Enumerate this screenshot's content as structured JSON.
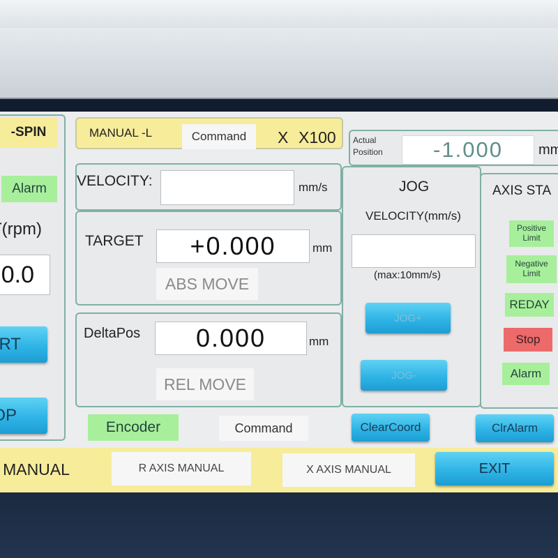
{
  "spindle_panel": {
    "title": "-SPIN",
    "alarm": "Alarm",
    "speed_label": "T(rpm)",
    "speed_value": "0.0",
    "start_button": "RT",
    "stop_button": "OP"
  },
  "header": {
    "mode": "MANUAL -L",
    "mode_button": "Command",
    "axis": "X",
    "scale": "X100",
    "actual_position_label": "Actual Position",
    "actual_position_value": "-1.000",
    "actual_position_unit": "mm"
  },
  "velocity": {
    "label": "VELOCITY:",
    "value": "",
    "unit": "mm/s"
  },
  "absolute": {
    "label": "TARGET",
    "value": "+0.000",
    "unit": "mm",
    "button": "ABS MOVE"
  },
  "relative": {
    "label": "DeltaPos",
    "value": "0.000",
    "unit": "mm",
    "button": "REL MOVE"
  },
  "jog": {
    "title": "JOG",
    "velocity_label": "VELOCITY(mm/s)",
    "velocity_value": "",
    "max_note": "(max:10mm/s)",
    "plus_button": "JOG+",
    "minus_button": "JOG-"
  },
  "axis_status": {
    "title": "AXIS STA",
    "positive_limit": "Positive Limit",
    "negative_limit": "Negative Limit",
    "ready": "REDAY",
    "stop": "Stop",
    "alarm": "Alarm"
  },
  "source_row": {
    "encoder": "Encoder",
    "command": "Command",
    "clear_coord": "ClearCoord",
    "clear_alarm": "ClrAlarm"
  },
  "footer_tabs": {
    "current": "MANUAL",
    "r_axis": "R AXIS MANUAL",
    "x_axis": "X AXIS MANUAL",
    "exit": "EXIT"
  },
  "colors": {
    "accent_blue": "#2fb4e6",
    "status_green": "#a8ef9c",
    "status_red": "#ec6a6a",
    "header_yellow": "#f7ec9a"
  }
}
